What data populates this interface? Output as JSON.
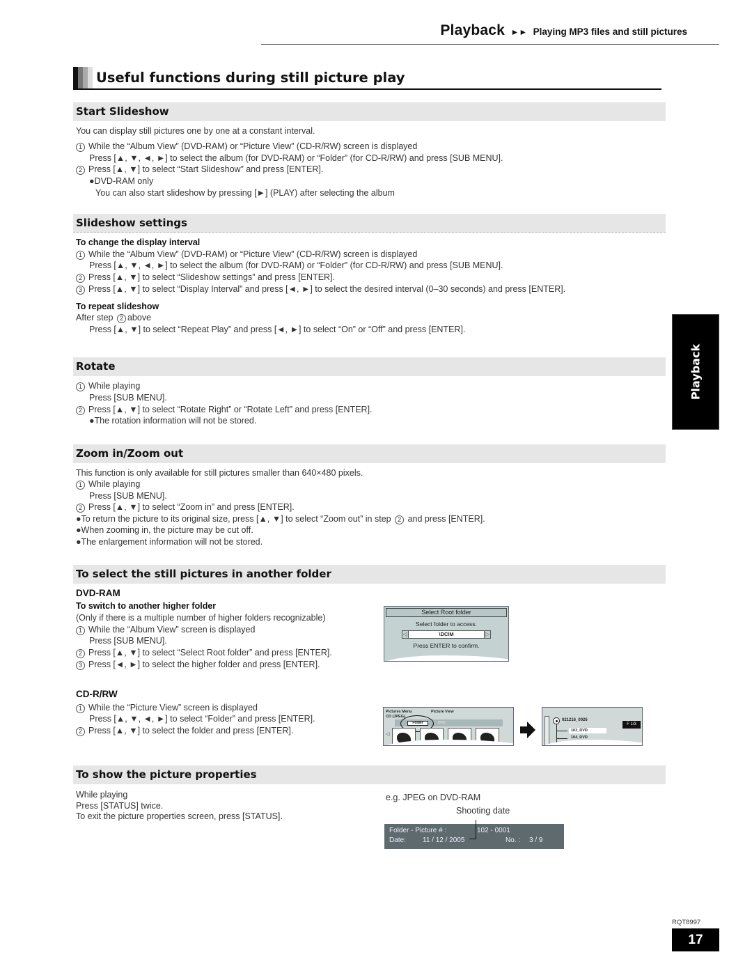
{
  "running_head": {
    "section": "Playback",
    "arrows": "►►",
    "subsection": "Playing MP3 files and still pictures"
  },
  "title": "Useful functions during still picture play",
  "side_tab": "Playback",
  "sections": {
    "start_slideshow": {
      "heading": "Start Slideshow",
      "intro": "You can display still pictures one by one at a constant interval.",
      "step1_num": "1",
      "step1_a": "While the “Album View” (DVD-RAM) or “Picture View” (CD-R/RW) screen is displayed",
      "step1_b": "Press [▲, ▼, ◄, ►] to select the album (for DVD-RAM) or “Folder” (for CD-R/RW) and press [SUB MENU].",
      "step2_num": "2",
      "step2": "Press [▲, ▼] to select “Start Slideshow” and press [ENTER].",
      "bullet": "●DVD-RAM only",
      "note": "You can also start slideshow by pressing [►] (PLAY) after selecting the album"
    },
    "slideshow_settings": {
      "heading": "Slideshow settings",
      "sub1": "To change the display interval",
      "step1_num": "1",
      "step1_a": "While the “Album View” (DVD-RAM) or “Picture View” (CD-R/RW) screen is displayed",
      "step1_b": "Press [▲, ▼, ◄, ►] to select the album (for DVD-RAM) or “Folder” (for CD-R/RW) and press [SUB MENU].",
      "step2_num": "2",
      "step2": "Press [▲, ▼] to select “Slideshow settings” and press [ENTER].",
      "step3_num": "3",
      "step3": "Press [▲, ▼] to select “Display Interval” and press [◄, ►] to select the desired interval (0–30 seconds) and press [ENTER].",
      "sub2": "To repeat slideshow",
      "after_a": "After step",
      "after_num": "2",
      "after_b": "above",
      "repeat": "Press [▲, ▼] to select “Repeat Play” and press [◄, ►] to select “On” or “Off” and press [ENTER]."
    },
    "rotate": {
      "heading": "Rotate",
      "step1_num": "1",
      "step1_a": "While playing",
      "step1_b": "Press [SUB MENU].",
      "step2_num": "2",
      "step2": "Press [▲, ▼] to select “Rotate Right” or “Rotate Left” and press [ENTER].",
      "bullet": "●The rotation information will not be stored."
    },
    "zoom": {
      "heading": "Zoom in/Zoom out",
      "intro": "This function is only available for still pictures smaller than 640×480 pixels.",
      "step1_num": "1",
      "step1_a": "While playing",
      "step1_b": "Press [SUB MENU].",
      "step2_num": "2",
      "step2": "Press [▲, ▼] to select “Zoom in” and press [ENTER].",
      "bullet1_a": "●To return the picture to its original size, press [▲, ▼] to select “Zoom out” in step",
      "bullet1_num": "2",
      "bullet1_b": "and press [ENTER].",
      "bullet2": "●When zooming in, the picture may be cut off.",
      "bullet3": "●The enlargement information will not be stored."
    },
    "another_folder": {
      "heading": "To select the still pictures in another folder",
      "dvd_label": "DVD-RAM",
      "dvd_sub": "To switch to another higher folder",
      "dvd_note": "(Only if there is a multiple number of higher folders recognizable)",
      "dvd_step1_num": "1",
      "dvd_step1_a": "While the “Album View” screen is displayed",
      "dvd_step1_b": "Press [SUB MENU].",
      "dvd_step2_num": "2",
      "dvd_step2": "Press [▲, ▼] to select “Select Root folder” and press [ENTER].",
      "dvd_step3_num": "3",
      "dvd_step3": "Press [◄, ►] to select the higher folder and press [ENTER].",
      "cd_label": "CD-R/RW",
      "cd_step1_num": "1",
      "cd_step1_a": "While the “Picture View” screen is displayed",
      "cd_step1_b": "Press [▲, ▼, ◄, ►] to select “Folder” and press [ENTER].",
      "cd_step2_num": "2",
      "cd_step2": "Press [▲, ▼] to select the folder and press [ENTER]."
    },
    "properties": {
      "heading": "To show the picture properties",
      "line1": "While playing",
      "line2": "Press [STATUS] twice.",
      "line3": "To exit the picture properties screen, press [STATUS]."
    }
  },
  "screens": {
    "select_root": {
      "header": "Select Root folder",
      "message": "Select folder to access.",
      "left_arrow": "◁",
      "value": "\\DCIM",
      "right_arrow": "▷",
      "confirm": "Press ENTER to confirm."
    },
    "picture_view": {
      "menu": "Pictures Menu",
      "view": "Picture View",
      "source": "CD (JPEG)",
      "folder_button": "Folder",
      "dvd_label": "DVD",
      "nav_left": "◁"
    },
    "folder_tree": {
      "root": "021216_0026",
      "items": [
        "103_DVD",
        "104_DVD"
      ],
      "page_badge": "F  1/3"
    },
    "properties": {
      "example": "e.g. JPEG on DVD-RAM",
      "callout": "Shooting date",
      "folder_label": "Folder - Picture # :",
      "folder_value": "102 - 0001",
      "date_label": "Date:",
      "date_value": "11 / 12 / 2005",
      "no_label": "No. :",
      "no_value": "3 /    9"
    }
  },
  "footer": {
    "doc_id": "RQT8997",
    "page_number": "17"
  }
}
